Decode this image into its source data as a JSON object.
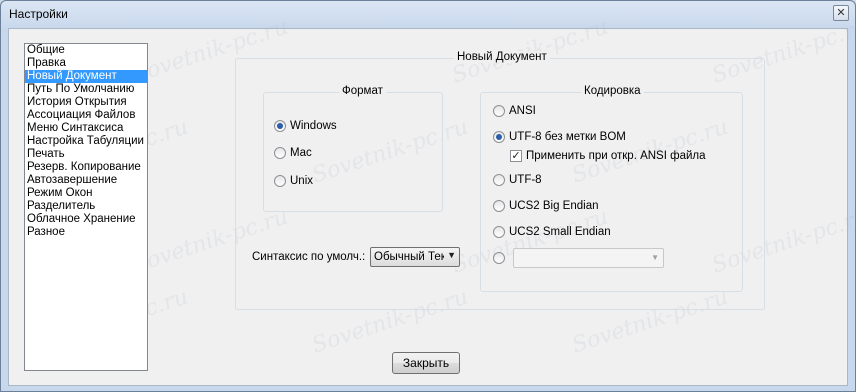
{
  "window": {
    "title": "Настройки",
    "close_symbol": "✕"
  },
  "nav": {
    "items": [
      {
        "label": "Общие"
      },
      {
        "label": "Правка"
      },
      {
        "label": "Новый Документ",
        "selected": true
      },
      {
        "label": "Путь По Умолчанию"
      },
      {
        "label": "История Открытия"
      },
      {
        "label": "Ассоциация Файлов"
      },
      {
        "label": "Меню Синтаксиса"
      },
      {
        "label": "Настройка Табуляции"
      },
      {
        "label": "Печать"
      },
      {
        "label": "Резерв. Копирование"
      },
      {
        "label": "Автозавершение"
      },
      {
        "label": "Режим Окон"
      },
      {
        "label": "Разделитель"
      },
      {
        "label": "Облачное Хранение"
      },
      {
        "label": "Разное"
      }
    ]
  },
  "new_document": {
    "title": "Новый Документ",
    "format": {
      "title": "Формат",
      "options": [
        {
          "label": "Windows",
          "checked": true
        },
        {
          "label": "Mac",
          "checked": false
        },
        {
          "label": "Unix",
          "checked": false
        }
      ]
    },
    "syntax": {
      "label": "Синтаксис по умолч.:",
      "value": "Обычный Тек",
      "arrow": "▼"
    },
    "encoding": {
      "title": "Кодировка",
      "options": [
        {
          "label": "ANSI",
          "checked": false
        },
        {
          "label": "UTF-8 без метки BOM",
          "checked": true
        },
        {
          "label": "UTF-8",
          "checked": false
        },
        {
          "label": "UCS2 Big Endian",
          "checked": false
        },
        {
          "label": "UCS2 Small Endian",
          "checked": false
        }
      ],
      "apply_ansi": {
        "label": "Применить при откр. ANSI файла",
        "checked": true,
        "mark": "✓"
      },
      "custom_arrow": "▼"
    }
  },
  "footer": {
    "close_label": "Закрыть"
  },
  "watermark": {
    "text": "Sovetnik-pc.ru"
  }
}
